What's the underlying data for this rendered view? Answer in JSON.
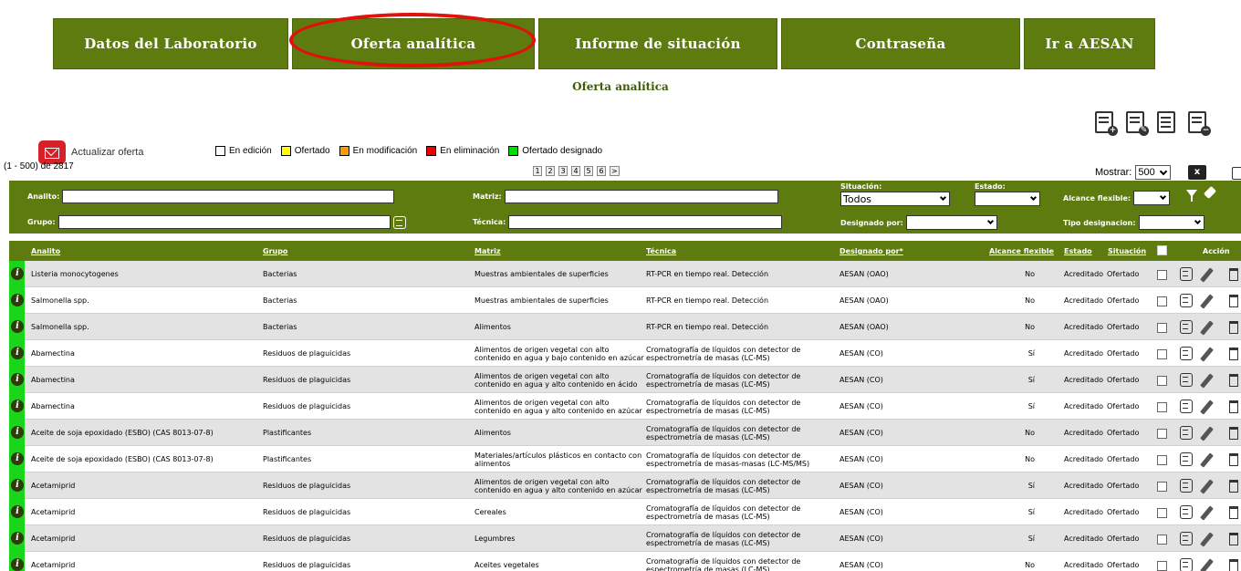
{
  "nav": [
    {
      "label": "Datos del Laboratorio"
    },
    {
      "label": "Oferta analítica"
    },
    {
      "label": "Informe de situación"
    },
    {
      "label": "Contraseña"
    },
    {
      "label": "Ir a AESAN"
    }
  ],
  "page_title": "Oferta analítica",
  "update_button": "Actualizar oferta",
  "legend": [
    {
      "label": "En edición",
      "color": "#ffffff"
    },
    {
      "label": "Ofertado",
      "color": "#ffff00"
    },
    {
      "label": "En modificación",
      "color": "#ff9900"
    },
    {
      "label": "En eliminación",
      "color": "#ee0000"
    },
    {
      "label": "Ofertado designado",
      "color": "#00dd00"
    }
  ],
  "range_text": "(1 - 500) de 2817",
  "pager": [
    "1",
    "2",
    "3",
    "4",
    "5",
    "6",
    ">"
  ],
  "show": {
    "label": "Mostrar:",
    "value": "500"
  },
  "xls_label": "x",
  "filters": {
    "analito_label": "Analito:",
    "grupo_label": "Grupo:",
    "matriz_label": "Matriz:",
    "tecnica_label": "Técnica:",
    "situacion_label": "Situación:",
    "situacion_value": "Todos",
    "estado_label": "Estado:",
    "alcance_label": "Alcance flexible:",
    "designado_label": "Designado por:",
    "tipo_label": "Tipo designacion:"
  },
  "headers": {
    "analito": "Analito",
    "grupo": "Grupo",
    "matriz": "Matriz",
    "tecnica": "Técnica",
    "designado": "Designado por*",
    "alcance": "Alcance flexible",
    "estado": "Estado",
    "situacion": "Situación",
    "accion": "Acción"
  },
  "rows": [
    {
      "analito": "Listeria monocytogenes",
      "grupo": "Bacterias",
      "matriz": "Muestras ambientales de superficies",
      "tecnica": "RT-PCR en tiempo real. Detección",
      "designado": "AESAN (OAO)",
      "alcance": "No",
      "estado": "Acreditado",
      "situacion": "Ofertado"
    },
    {
      "analito": "Salmonella spp.",
      "grupo": "Bacterias",
      "matriz": "Muestras ambientales de superficies",
      "tecnica": "RT-PCR en tiempo real. Detección",
      "designado": "AESAN (OAO)",
      "alcance": "No",
      "estado": "Acreditado",
      "situacion": "Ofertado"
    },
    {
      "analito": "Salmonella spp.",
      "grupo": "Bacterias",
      "matriz": "Alimentos",
      "tecnica": "RT-PCR en tiempo real. Detección",
      "designado": "AESAN (OAO)",
      "alcance": "No",
      "estado": "Acreditado",
      "situacion": "Ofertado"
    },
    {
      "analito": "Abamectina",
      "grupo": "Residuos de plaguicidas",
      "matriz": "Alimentos de origen vegetal con alto contenido en agua y bajo contenido en azúcar",
      "tecnica": "Cromatografía de líquidos con detector de espectrometría de masas (LC-MS)",
      "designado": "AESAN (CO)",
      "alcance": "Sí",
      "estado": "Acreditado",
      "situacion": "Ofertado"
    },
    {
      "analito": "Abamectina",
      "grupo": "Residuos de plaguicidas",
      "matriz": "Alimentos de origen vegetal con alto contenido en agua y alto contenido en ácido",
      "tecnica": "Cromatografía de líquidos con detector de espectrometría de masas (LC-MS)",
      "designado": "AESAN (CO)",
      "alcance": "Sí",
      "estado": "Acreditado",
      "situacion": "Ofertado"
    },
    {
      "analito": "Abamectina",
      "grupo": "Residuos de plaguicidas",
      "matriz": "Alimentos de origen vegetal con alto contenido en agua y alto contenido en azúcar",
      "tecnica": "Cromatografía de líquidos con detector de espectrometría de masas (LC-MS)",
      "designado": "AESAN (CO)",
      "alcance": "Sí",
      "estado": "Acreditado",
      "situacion": "Ofertado"
    },
    {
      "analito": "Aceite de soja epoxidado (ESBO) (CAS 8013-07-8)",
      "grupo": "Plastificantes",
      "matriz": "Alimentos",
      "tecnica": "Cromatografía de líquidos con detector de espectrometría de masas (LC-MS)",
      "designado": "AESAN (CO)",
      "alcance": "No",
      "estado": "Acreditado",
      "situacion": "Ofertado"
    },
    {
      "analito": "Aceite de soja epoxidado (ESBO) (CAS 8013-07-8)",
      "grupo": "Plastificantes",
      "matriz": "Materiales/artículos plásticos en contacto con alimentos",
      "tecnica": "Cromatografía de líquidos con detector de espectrometría de masas-masas (LC-MS/MS)",
      "designado": "AESAN (CO)",
      "alcance": "No",
      "estado": "Acreditado",
      "situacion": "Ofertado"
    },
    {
      "analito": "Acetamiprid",
      "grupo": "Residuos de plaguicidas",
      "matriz": "Alimentos de origen vegetal con alto contenido en agua y alto contenido en azúcar",
      "tecnica": "Cromatografía de líquidos con detector de espectrometría de masas (LC-MS)",
      "designado": "AESAN (CO)",
      "alcance": "Sí",
      "estado": "Acreditado",
      "situacion": "Ofertado"
    },
    {
      "analito": "Acetamiprid",
      "grupo": "Residuos de plaguicidas",
      "matriz": "Cereales",
      "tecnica": "Cromatografía de líquidos con detector de espectrometría de masas (LC-MS)",
      "designado": "AESAN (CO)",
      "alcance": "Sí",
      "estado": "Acreditado",
      "situacion": "Ofertado"
    },
    {
      "analito": "Acetamiprid",
      "grupo": "Residuos de plaguicidas",
      "matriz": "Legumbres",
      "tecnica": "Cromatografía de líquidos con detector de espectrometría de masas (LC-MS)",
      "designado": "AESAN (CO)",
      "alcance": "Sí",
      "estado": "Acreditado",
      "situacion": "Ofertado"
    },
    {
      "analito": "Acetamiprid",
      "grupo": "Residuos de plaguicidas",
      "matriz": "Aceites vegetales",
      "tecnica": "Cromatografía de líquidos con detector de espectrometría de masas (LC-MS)",
      "designado": "AESAN (CO)",
      "alcance": "No",
      "estado": "Acreditado",
      "situacion": "Ofertado"
    }
  ]
}
